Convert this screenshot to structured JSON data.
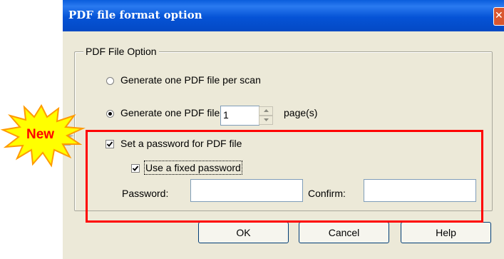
{
  "window": {
    "title": "PDF file format option",
    "close_glyph": "✕"
  },
  "group": {
    "legend": "PDF File Option"
  },
  "options": {
    "per_scan_label": "Generate one PDF file per scan",
    "per_scan_selected": false,
    "per_pages_label": "Generate one PDF file per",
    "per_pages_selected": true,
    "pages_value": "1",
    "pages_unit": "page(s)"
  },
  "password": {
    "set_password_label": "Set a password for PDF file",
    "set_password_checked": true,
    "fixed_password_label": "Use a fixed password",
    "fixed_password_checked": true,
    "password_label": "Password:",
    "password_value": "",
    "confirm_label": "Confirm:",
    "confirm_value": ""
  },
  "buttons": {
    "ok": "OK",
    "cancel": "Cancel",
    "help": "Help"
  },
  "callout": {
    "badge_text": "New",
    "badge_color": "#ffff00",
    "badge_text_color": "#ff0000",
    "highlight_color": "#ff0000"
  },
  "icons": [
    "radio-button",
    "checkbox-check-icon",
    "spin-up-icon",
    "spin-down-icon",
    "close-icon",
    "new-starburst-icon"
  ]
}
